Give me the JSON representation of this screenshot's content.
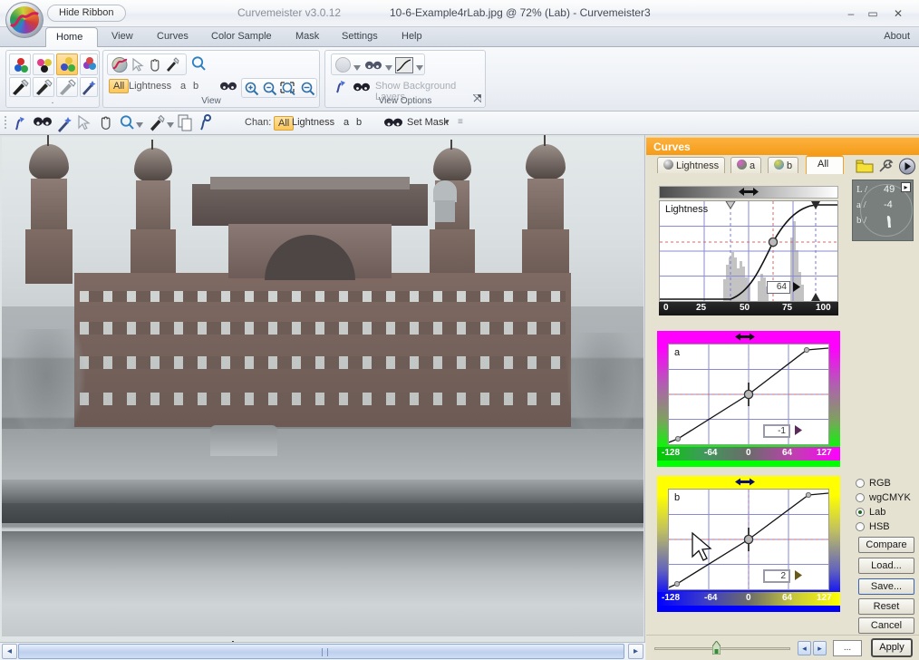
{
  "titlebar": {
    "hide_ribbon_label": "Hide Ribbon",
    "caret_icon": "chevron-down-icon",
    "app_version": "Curvemeister v3.0.12",
    "document_title": "10-6-Example4rLab.jpg @ 72% (Lab)  -  Curvemeister3",
    "minimize_glyph": "–",
    "maximize_glyph": "▭",
    "close_glyph": "✕"
  },
  "ribbon_tabs": {
    "items": [
      {
        "label": "Home",
        "active": true
      },
      {
        "label": "View",
        "active": false
      },
      {
        "label": "Curves",
        "active": false
      },
      {
        "label": "Color Sample",
        "active": false
      },
      {
        "label": "Mask",
        "active": false
      },
      {
        "label": "Settings",
        "active": false
      },
      {
        "label": "Help",
        "active": false
      }
    ],
    "about_label": "About"
  },
  "ribbon": {
    "groups": [
      {
        "name": "eyedropper-group",
        "label": "."
      },
      {
        "name": "view-group",
        "label": "View"
      },
      {
        "name": "view-options-group",
        "label": "View Options"
      }
    ],
    "view_group": {
      "channel_all": "All",
      "channel_lightness": "Lightness",
      "channel_a": "a",
      "channel_b": "b"
    },
    "view_options": {
      "show_background_layers": "Show Background Layers"
    }
  },
  "toolbar2": {
    "chan_label": "Chan:",
    "channel_all": "All",
    "channel_lightness": "Lightness",
    "channel_a": "a",
    "channel_b": "b",
    "set_mask_label": "Set Mask",
    "set_mask_caret": "▾",
    "overflow_glyph": "≡"
  },
  "curves_panel": {
    "header_title": "Curves",
    "tabs": [
      {
        "label": "Lightness",
        "active": false
      },
      {
        "label": "a",
        "active": false
      },
      {
        "label": "b",
        "active": false
      },
      {
        "label": "All",
        "active": true
      }
    ],
    "toolbar_icons": [
      "folder-icon",
      "wrench-icon",
      "play-icon"
    ],
    "lab_readout": {
      "l_label": "L /",
      "l_value": "49",
      "a_label": "a /",
      "a_value": "-4",
      "b_label": "b /",
      "b_value": "",
      "expand_glyph": "▸"
    },
    "colorspaces": [
      {
        "label": "RGB",
        "selected": false
      },
      {
        "label": "wgCMYK",
        "selected": false
      },
      {
        "label": "Lab",
        "selected": true
      },
      {
        "label": "HSB",
        "selected": false
      }
    ],
    "buttons": [
      {
        "label": "Compare",
        "focused": false
      },
      {
        "label": "Load...",
        "focused": false
      },
      {
        "label": "Save...",
        "focused": true
      },
      {
        "label": "Reset",
        "focused": false
      },
      {
        "label": "Cancel",
        "focused": false
      },
      {
        "label": "Apply",
        "focused": false
      }
    ]
  },
  "bottom_controls": {
    "prev_glyph": "◂",
    "next_glyph": "▸",
    "dots_label": "...",
    "apply_label": "Apply"
  },
  "hscrollbar": {
    "left_glyph": "◂",
    "right_glyph": "▸"
  },
  "canvas": {
    "cursor": "crosshair-eyedropper-cursor"
  },
  "chart_data": [
    {
      "type": "line",
      "name": "lightness-curve",
      "title": "Lightness",
      "xlabel": "",
      "ylabel": "",
      "xlim": [
        0,
        100
      ],
      "ylim": [
        0,
        100
      ],
      "tick_labels": [
        "0",
        "25",
        "50",
        "75",
        "100"
      ],
      "tick_values": [
        0,
        25,
        50,
        75,
        100
      ],
      "grid": true,
      "value_box": "64",
      "control_points": [
        {
          "x": 0,
          "y": 0
        },
        {
          "x": 40,
          "y": 0
        },
        {
          "x": 64,
          "y": 55
        },
        {
          "x": 88,
          "y": 100
        },
        {
          "x": 100,
          "y": 100
        }
      ],
      "markers": [
        {
          "x": 40,
          "type": "shadow-marker"
        },
        {
          "x": 88,
          "type": "highlight-marker"
        }
      ],
      "selected_point": {
        "x": 64,
        "y": 55
      },
      "histogram": true,
      "gradient": "black-to-white"
    },
    {
      "type": "line",
      "name": "a-channel-curve",
      "title": "a",
      "xlabel": "",
      "ylabel": "",
      "xlim": [
        -128,
        127
      ],
      "ylim": [
        -128,
        127
      ],
      "tick_labels": [
        "-128",
        "-64",
        "0",
        "64",
        "127"
      ],
      "tick_values": [
        -128,
        -64,
        0,
        64,
        127
      ],
      "grid": true,
      "value_box": "-1",
      "control_points": [
        {
          "x": -128,
          "y": -128
        },
        {
          "x": -110,
          "y": -118
        },
        {
          "x": 0,
          "y": -1
        },
        {
          "x": 85,
          "y": 118
        },
        {
          "x": 127,
          "y": 127
        }
      ],
      "selected_point": {
        "x": 0,
        "y": -1
      },
      "gradient": "green-to-magenta"
    },
    {
      "type": "line",
      "name": "b-channel-curve",
      "title": "b",
      "xlabel": "",
      "ylabel": "",
      "xlim": [
        -128,
        127
      ],
      "ylim": [
        -128,
        127
      ],
      "tick_labels": [
        "-128",
        "-64",
        "0",
        "64",
        "127"
      ],
      "tick_values": [
        -128,
        -64,
        0,
        64,
        127
      ],
      "grid": true,
      "value_box": "2",
      "control_points": [
        {
          "x": -128,
          "y": -128
        },
        {
          "x": -112,
          "y": -122
        },
        {
          "x": 0,
          "y": 2
        },
        {
          "x": 88,
          "y": 120
        },
        {
          "x": 127,
          "y": 127
        }
      ],
      "selected_point": {
        "x": 0,
        "y": 2
      },
      "gradient": "blue-to-yellow"
    }
  ]
}
